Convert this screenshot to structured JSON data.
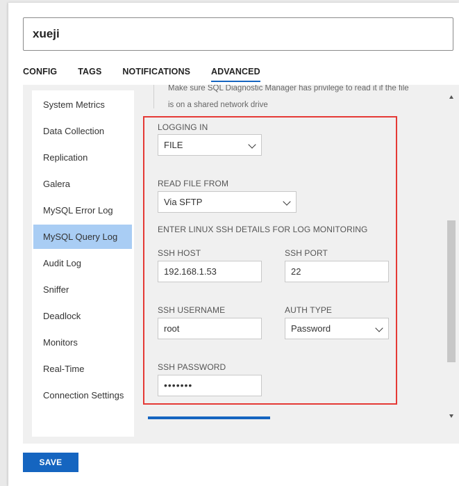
{
  "profile": {
    "name": "xueji"
  },
  "tabs": [
    {
      "label": "CONFIG"
    },
    {
      "label": "TAGS"
    },
    {
      "label": "NOTIFICATIONS"
    },
    {
      "label": "ADVANCED",
      "active": true
    }
  ],
  "sidebar": {
    "items": [
      {
        "label": "System Metrics"
      },
      {
        "label": "Data Collection"
      },
      {
        "label": "Replication"
      },
      {
        "label": "Galera"
      },
      {
        "label": "MySQL Error Log"
      },
      {
        "label": "MySQL Query Log",
        "active": true
      },
      {
        "label": "Audit Log"
      },
      {
        "label": "Sniffer"
      },
      {
        "label": "Deadlock"
      },
      {
        "label": "Monitors"
      },
      {
        "label": "Real-Time"
      },
      {
        "label": "Connection Settings"
      }
    ]
  },
  "content": {
    "hint_line1": "Make sure SQL Diagnostic Manager has privilege to read it if the file",
    "hint_line2": "is on a shared network drive",
    "logging_in": {
      "label": "LOGGING IN",
      "value": "FILE"
    },
    "read_file_from": {
      "label": "READ FILE FROM",
      "value": "Via SFTP"
    },
    "ssh_section_title": "ENTER LINUX SSH DETAILS FOR LOG MONITORING",
    "ssh_host": {
      "label": "SSH HOST",
      "value": "192.168.1.53"
    },
    "ssh_port": {
      "label": "SSH PORT",
      "value": "22"
    },
    "ssh_username": {
      "label": "SSH USERNAME",
      "value": "root"
    },
    "auth_type": {
      "label": "AUTH TYPE",
      "value": "Password"
    },
    "ssh_password": {
      "label": "SSH PASSWORD",
      "value": "•••••••"
    }
  },
  "footer": {
    "save_label": "SAVE"
  },
  "colors": {
    "accent": "#1565c0",
    "highlight": "#e53935",
    "selected": "#a9cdf4"
  }
}
